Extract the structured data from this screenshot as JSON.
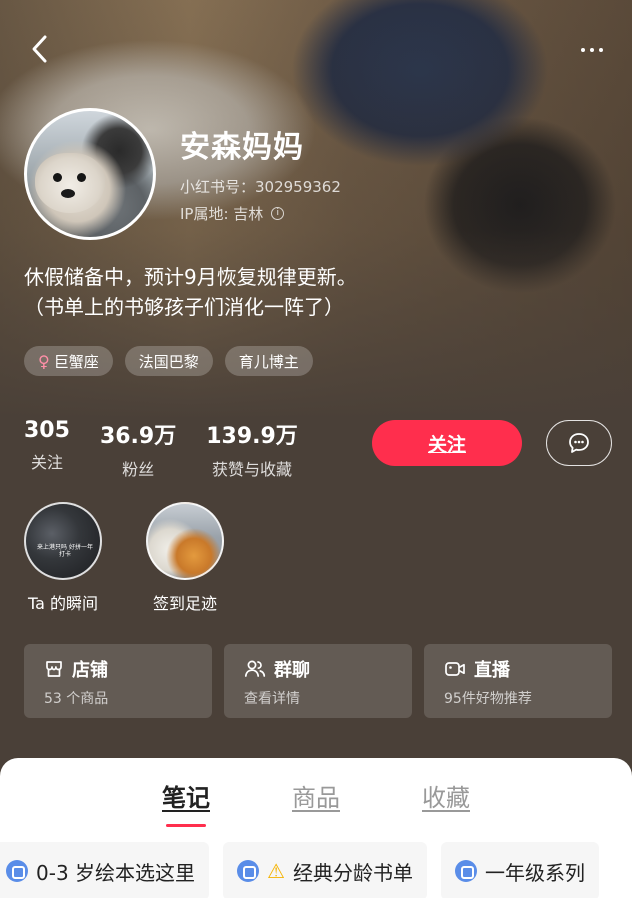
{
  "profile": {
    "nickname": "安森妈妈",
    "account_id": "小红书号：302959362",
    "ip_location": "IP属地: 吉林",
    "bio_line1": "休假储备中，预计9月恢复规律更新。",
    "bio_line2": "（书单上的书够孩子们消化一阵了）",
    "tags": [
      "巨蟹座",
      "法国巴黎",
      "育儿博主"
    ]
  },
  "stats": [
    {
      "value": "305",
      "label": "关注"
    },
    {
      "value": "36.9万",
      "label": "粉丝"
    },
    {
      "value": "139.9万",
      "label": "获赞与收藏"
    }
  ],
  "actions": {
    "follow_label": "关注"
  },
  "moments": [
    {
      "label": "Ta 的瞬间",
      "caption": "来上港只吗\n好拼一年打卡"
    },
    {
      "label": "签到足迹"
    }
  ],
  "shortcuts": [
    {
      "icon": "shop-icon",
      "title": "店铺",
      "subtitle": "53 个商品"
    },
    {
      "icon": "group-chat-icon",
      "title": "群聊",
      "subtitle": "查看详情"
    },
    {
      "icon": "live-icon",
      "title": "直播",
      "subtitle": "95件好物推荐"
    }
  ],
  "tabs": [
    {
      "label": "笔记",
      "active": true
    },
    {
      "label": "商品",
      "active": false
    },
    {
      "label": "收藏",
      "active": false
    }
  ],
  "collections": [
    {
      "label": "0-3 岁绘本选这里"
    },
    {
      "label": "经典分龄书单",
      "warning": true
    },
    {
      "label": "一年级系列"
    }
  ],
  "colors": {
    "accent": "#ff2e4d",
    "background": "#4a4038"
  }
}
